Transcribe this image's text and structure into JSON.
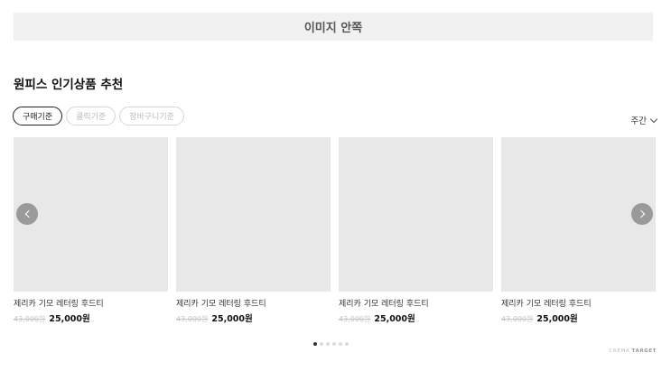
{
  "banner": {
    "text": "이미지 안쪽"
  },
  "section": {
    "title": "원피스 인기상품 추천"
  },
  "tabs": [
    {
      "label": "구매기준",
      "active": true
    },
    {
      "label": "클릭기준",
      "active": false
    },
    {
      "label": "장바구니기준",
      "active": false
    }
  ],
  "period": {
    "label": "주간"
  },
  "products": [
    {
      "name": "제리카 기모 레터링 후드티",
      "original_price": "43,000원",
      "sale_price": "25,000원"
    },
    {
      "name": "제리카 기모 레터링 후드티",
      "original_price": "43,000원",
      "sale_price": "25,000원"
    },
    {
      "name": "제리카 기모 레터링 후드티",
      "original_price": "43,000원",
      "sale_price": "25,000원"
    },
    {
      "name": "제리카 기모 레터링 후드티",
      "original_price": "43,000원",
      "sale_price": "25,000원"
    }
  ],
  "pagination": {
    "total": 6,
    "current": 1
  },
  "brand": {
    "prefix": "CREMA",
    "suffix": "TARGET"
  },
  "icons": {
    "prev": "chevron-left-icon",
    "next": "chevron-right-icon",
    "period": "chevron-down-icon"
  },
  "colors": {
    "banner_bg": "#f1f1f1",
    "thumb_bg": "#e8e8e8",
    "nav_button": "#9a9a9a",
    "active_dot": "#333333"
  }
}
